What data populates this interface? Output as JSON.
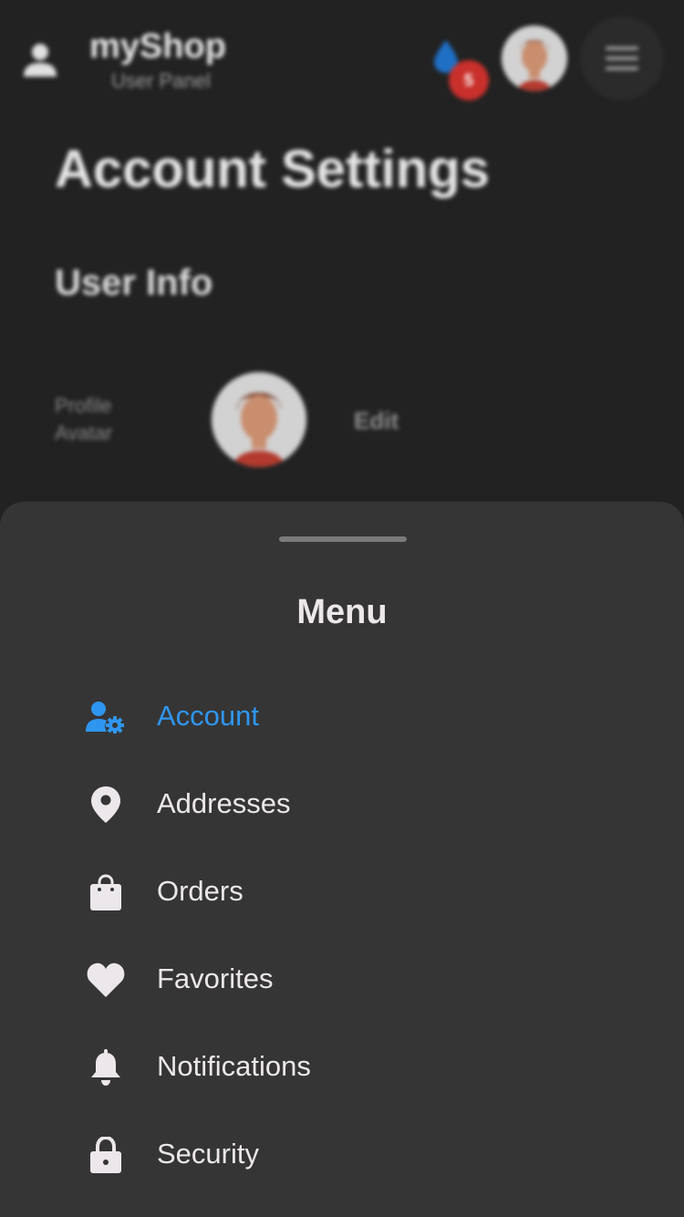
{
  "app": {
    "brand_name": "myShop",
    "brand_subtitle": "User Panel",
    "notification_count": "5"
  },
  "page": {
    "title": "Account Settings",
    "section_title": "User Info",
    "avatar_label": "Profile Avatar",
    "edit_label": "Edit"
  },
  "sheet": {
    "title": "Menu",
    "items": [
      {
        "label": "Account",
        "icon": "user-gear-icon",
        "active": true
      },
      {
        "label": "Addresses",
        "icon": "location-pin-icon",
        "active": false
      },
      {
        "label": "Orders",
        "icon": "shopping-bag-icon",
        "active": false
      },
      {
        "label": "Favorites",
        "icon": "heart-icon",
        "active": false
      },
      {
        "label": "Notifications",
        "icon": "bell-icon",
        "active": false
      },
      {
        "label": "Security",
        "icon": "lock-icon",
        "active": false
      }
    ]
  },
  "colors": {
    "background": "#222222",
    "sheet": "#353535",
    "accent": "#2f96f0",
    "text": "#ece7ea",
    "badge": "#c9302c"
  }
}
